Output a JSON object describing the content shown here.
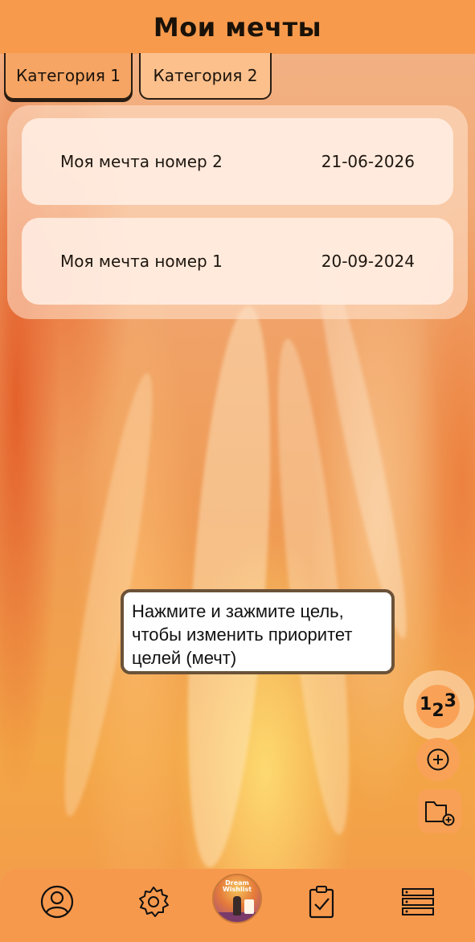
{
  "header": {
    "title": "Мои мечты"
  },
  "tabs": [
    {
      "label": "Категория 1",
      "active": true
    },
    {
      "label": "Категория 2",
      "active": false
    }
  ],
  "dreams": [
    {
      "title": "Моя мечта номер 2",
      "date": "21-06-2026"
    },
    {
      "title": "Моя мечта номер 1",
      "date": "20-09-2024"
    }
  ],
  "tooltip": {
    "line1": "Нажмите и зажмите цель,",
    "line2": "чтобы изменить приоритет",
    "line3": "целей (мечт)"
  },
  "fab": {
    "priority_d1": "1",
    "priority_d2": "2",
    "priority_d3": "3",
    "add_icon": "plus-circle-icon",
    "folder_icon": "folder-add-icon"
  },
  "center_app": {
    "line1": "Dream",
    "line2": "Wishlist"
  },
  "bottom_nav": {
    "items": [
      "profile-icon",
      "settings-icon",
      "app-logo",
      "tasks-icon",
      "list-icon"
    ]
  },
  "colors": {
    "accent": "#f89a4c",
    "tab_active": "#f6a564",
    "tab_inactive": "#fbc08c",
    "card": "#ffeee4",
    "tooltip_border": "#6b5238"
  }
}
